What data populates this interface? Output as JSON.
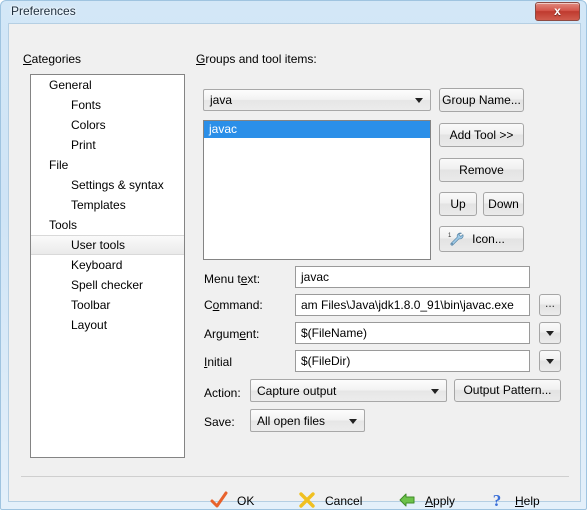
{
  "window": {
    "title": "Preferences",
    "close_label": "x",
    "close_icon": "close-icon"
  },
  "categories": {
    "header": "Categories",
    "header_mnemonic": "C",
    "items": [
      {
        "label": "General",
        "level": 1,
        "selected": false
      },
      {
        "label": "Fonts",
        "level": 2,
        "selected": false
      },
      {
        "label": "Colors",
        "level": 2,
        "selected": false
      },
      {
        "label": "Print",
        "level": 2,
        "selected": false
      },
      {
        "label": "File",
        "level": 1,
        "selected": false
      },
      {
        "label": "Settings & syntax",
        "level": 2,
        "selected": false
      },
      {
        "label": "Templates",
        "level": 2,
        "selected": false
      },
      {
        "label": "Tools",
        "level": 1,
        "selected": false
      },
      {
        "label": "User tools",
        "level": 2,
        "selected": true
      },
      {
        "label": "Keyboard",
        "level": 2,
        "selected": false
      },
      {
        "label": "Spell checker",
        "level": 2,
        "selected": false
      },
      {
        "label": "Toolbar",
        "level": 2,
        "selected": false
      },
      {
        "label": "Layout",
        "level": 2,
        "selected": false
      }
    ]
  },
  "groups": {
    "header": "Groups and tool items:",
    "header_mnemonic": "G",
    "selected_group": "java",
    "tools": [
      {
        "label": "javac",
        "selected": true
      }
    ],
    "selection_color": "#2b8fe8"
  },
  "side_buttons": {
    "group_name": "Group Name...",
    "add_tool": "Add Tool >>",
    "remove": "Remove",
    "up": "Up",
    "down": "Down",
    "icon": "Icon...",
    "icon_glyph": "wrench-icon"
  },
  "form": {
    "menu_text": {
      "label": "Menu text:",
      "value": "javac"
    },
    "command": {
      "label": "Command:",
      "value": "am Files\\Java\\jdk1.8.0_91\\bin\\javac.exe",
      "browse_label": "..."
    },
    "argument": {
      "label": "Argument:",
      "value": "$(FileName)"
    },
    "initial": {
      "label": "Initial",
      "value": "$(FileDir)"
    },
    "action": {
      "label": "Action:",
      "value": "Capture output"
    },
    "save": {
      "label": "Save:",
      "value": "All open files"
    },
    "output_pattern_button": "Output Pattern..."
  },
  "footer": {
    "ok": {
      "label": "OK",
      "icon": "check-icon",
      "color": "#e8622c"
    },
    "cancel": {
      "label": "Cancel",
      "icon": "x-icon",
      "color": "#f0c020"
    },
    "apply": {
      "label": "Apply",
      "icon": "arrow-left-icon",
      "color": "#6cc24a"
    },
    "help": {
      "label": "Help",
      "icon": "question-icon",
      "color": "#3a6fd8"
    }
  }
}
